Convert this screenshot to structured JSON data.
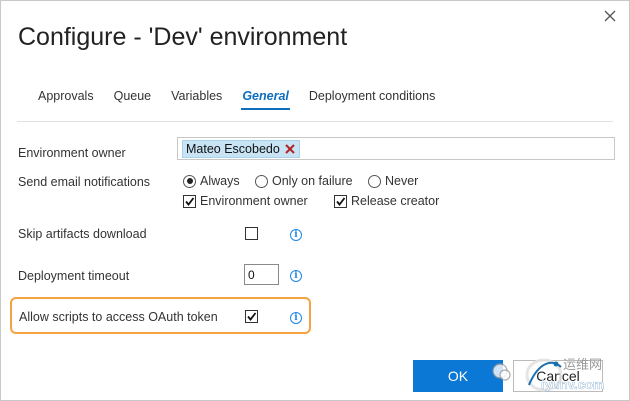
{
  "dialog": {
    "title": "Configure - 'Dev' environment",
    "close_icon": "close-icon"
  },
  "tabs": [
    {
      "label": "Approvals",
      "active": false
    },
    {
      "label": "Queue",
      "active": false
    },
    {
      "label": "Variables",
      "active": false
    },
    {
      "label": "General",
      "active": true
    },
    {
      "label": "Deployment conditions",
      "active": false
    }
  ],
  "general": {
    "environment_owner": {
      "label": "Environment owner",
      "value": "Mateo Escobedo",
      "remove_icon": "remove-x-icon"
    },
    "email_notifications": {
      "label": "Send email notifications",
      "options": [
        {
          "label": "Always",
          "selected": true
        },
        {
          "label": "Only on failure",
          "selected": false
        },
        {
          "label": "Never",
          "selected": false
        }
      ],
      "recipients": [
        {
          "label": "Environment owner",
          "checked": true
        },
        {
          "label": "Release creator",
          "checked": true
        }
      ]
    },
    "skip_artifacts": {
      "label": "Skip artifacts download",
      "checked": false,
      "info_icon": "info-icon"
    },
    "deployment_timeout": {
      "label": "Deployment timeout",
      "value": "0",
      "info_icon": "info-icon"
    },
    "oauth_token": {
      "label": "Allow scripts to access OAuth token",
      "checked": true,
      "highlighted": true,
      "info_icon": "info-icon"
    }
  },
  "buttons": {
    "ok_label": "OK",
    "cancel_label": "Cancel"
  },
  "watermark": {
    "site_text": "运维网",
    "url_text": "iyunv.com"
  },
  "colors": {
    "accent": "#0a78d4",
    "active_tab": "#106ebe",
    "highlight_border": "#f4a340",
    "chip_background": "#c7e3f4",
    "chip_remove": "#b22222",
    "info": "#1e88e5"
  }
}
